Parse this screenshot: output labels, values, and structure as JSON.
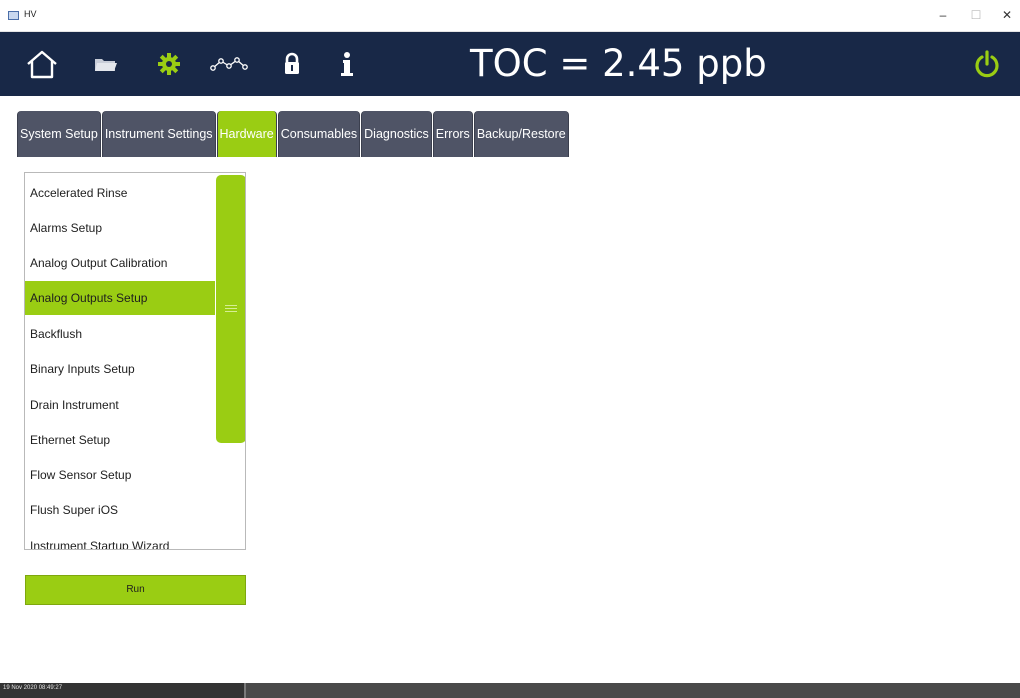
{
  "window": {
    "title": "HV",
    "minimize": "–",
    "maximize": "☐",
    "close": "✕"
  },
  "header": {
    "icons": [
      "home-icon",
      "folder-icon",
      "gear-icon",
      "trend-icon",
      "lock-icon",
      "info-icon",
      "power-icon"
    ],
    "reading": "TOC = 2.45 ppb",
    "accent_color": "#9acd13",
    "background_color": "#182847"
  },
  "tabs": [
    {
      "label": "System Setup",
      "active": false
    },
    {
      "label": "Instrument Settings",
      "active": false
    },
    {
      "label": "Hardware",
      "active": true
    },
    {
      "label": "Consumables",
      "active": false
    },
    {
      "label": "Diagnostics",
      "active": false
    },
    {
      "label": "Errors",
      "active": false
    },
    {
      "label": "Backup/Restore",
      "active": false
    }
  ],
  "list": {
    "items": [
      {
        "label": "Accelerated Rinse",
        "selected": false
      },
      {
        "label": "Alarms Setup",
        "selected": false
      },
      {
        "label": "Analog Output Calibration",
        "selected": false
      },
      {
        "label": "Analog Outputs Setup",
        "selected": true
      },
      {
        "label": "Backflush",
        "selected": false
      },
      {
        "label": "Binary Inputs Setup",
        "selected": false
      },
      {
        "label": "Drain Instrument",
        "selected": false
      },
      {
        "label": "Ethernet Setup",
        "selected": false
      },
      {
        "label": "Flow Sensor Setup",
        "selected": false
      },
      {
        "label": "Flush Super iOS",
        "selected": false
      },
      {
        "label": "Instrument Startup Wizard",
        "selected": false
      }
    ]
  },
  "run_button": {
    "label": "Run"
  },
  "status": {
    "timestamp": "19 Nov 2020 08:49:27"
  }
}
